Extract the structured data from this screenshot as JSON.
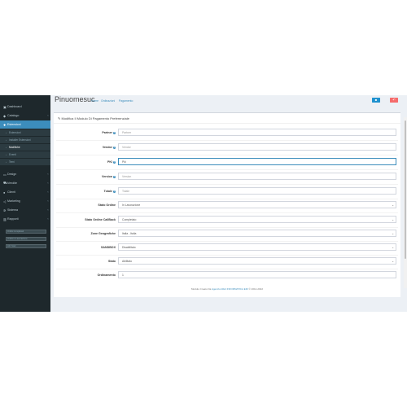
{
  "page": {
    "title": "Pinuomesuc",
    "breadcrumb": [
      {
        "label": "Home"
      },
      {
        "label": "Ordinazioni"
      },
      {
        "label": "Pagamento"
      }
    ]
  },
  "sidebar": {
    "items": [
      {
        "label": "Dashboard",
        "icon": "dashboard-icon"
      },
      {
        "label": "Catalogo",
        "icon": "tag-icon"
      },
      {
        "label": "Estensioni",
        "icon": "puzzle-icon",
        "active": true
      }
    ],
    "subitems": [
      {
        "label": "Estensioni"
      },
      {
        "label": "Installer Estensioni"
      },
      {
        "label": "Modifiche",
        "active": true
      },
      {
        "label": "Eventi"
      },
      {
        "label": "Temi"
      }
    ],
    "items2": [
      {
        "label": "Design",
        "icon": "television-icon"
      },
      {
        "label": "Vendite",
        "icon": "cart-icon"
      },
      {
        "label": "Clienti",
        "icon": "user-icon"
      },
      {
        "label": "Marketing",
        "icon": "share-icon"
      },
      {
        "label": "Sistema",
        "icon": "cog-icon"
      },
      {
        "label": "Rapporti",
        "icon": "bar-chart-icon"
      }
    ],
    "mini_fields": [
      {
        "label": "Ordini Completati"
      },
      {
        "label": "Ordini in Lavorazione"
      },
      {
        "label": "Altri Stati"
      }
    ]
  },
  "header_buttons": {
    "save_icon": "save-icon",
    "cancel_icon": "reply-icon",
    "save_color": "#1e91cf",
    "cancel_color": "#f56b6b"
  },
  "box": {
    "title": "Modifica Il Modulo Di Pagamento Preferenziale",
    "title_icon": "pencil-icon"
  },
  "form": {
    "fields": [
      {
        "label": "Partner",
        "help": true,
        "value": "",
        "placeholder": "Partner",
        "type": "input"
      },
      {
        "label": "Vendor",
        "help": true,
        "value": "",
        "placeholder": "Vendor",
        "type": "input"
      },
      {
        "label": "PKI",
        "help": true,
        "value": "",
        "placeholder": "Pki",
        "type": "input",
        "focused": true
      },
      {
        "label": "Version",
        "help": true,
        "value": "",
        "placeholder": "Version",
        "type": "input"
      },
      {
        "label": "Totale",
        "help": true,
        "value": "",
        "placeholder": "Totale",
        "type": "input"
      },
      {
        "label": "Stato Ordine",
        "help": false,
        "value": "In Lavorazione",
        "type": "select"
      },
      {
        "label": "Stato Ordine CallBack",
        "help": false,
        "value": "Completato",
        "type": "select"
      },
      {
        "label": "Zone Geografiche",
        "help": false,
        "value": "Italia - Italia",
        "type": "select"
      },
      {
        "label": "SANDBOX",
        "help": false,
        "value": "Disabilitato",
        "type": "select"
      },
      {
        "label": "Stato",
        "help": false,
        "value": "Abilitato",
        "type": "select"
      },
      {
        "label": "Ordinamento",
        "help": false,
        "value": "1",
        "type": "input"
      }
    ]
  },
  "footer": {
    "prefix": "Modulo Creato Da",
    "link": "Agenzia Web INFORMATICA EDI",
    "suffix": "© 2014-2022"
  },
  "colors": {
    "sidebar_bg": "#1e282c",
    "sidebar_active": "#3c8dbc",
    "content_bg": "#ecf0f5",
    "accent": "#3c8dbc"
  }
}
